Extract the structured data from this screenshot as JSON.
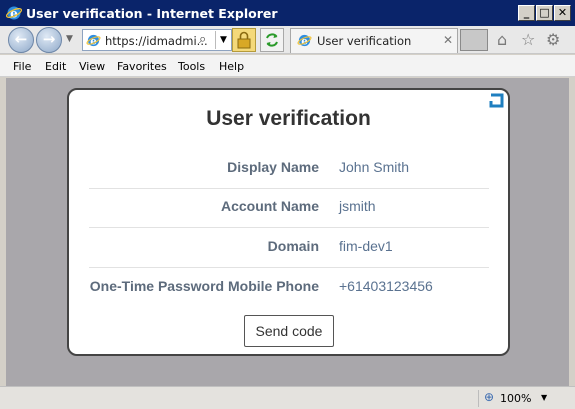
{
  "window": {
    "title": "User verification - Internet Explorer",
    "min_glyph": "_",
    "max_glyph": "□",
    "close_glyph": "✕"
  },
  "navbar": {
    "back_glyph": "←",
    "forward_glyph": "→",
    "address_url": "https://idmadmi...",
    "tab_label": "User verification",
    "tab_close_glyph": "✕",
    "icons": [
      "home-icon",
      "favorites-star-icon",
      "tools-gear-icon"
    ]
  },
  "menubar": {
    "items": [
      "File",
      "Edit",
      "View",
      "Favorites",
      "Tools",
      "Help"
    ]
  },
  "card": {
    "title": "User verification",
    "rows": [
      {
        "label": "Display Name",
        "value": "John Smith"
      },
      {
        "label": "Account Name",
        "value": "jsmith"
      },
      {
        "label": "Domain",
        "value": "fim-dev1"
      },
      {
        "label": "One-Time Password Mobile Phone",
        "value": "+61403123456"
      }
    ],
    "button_label": "Send code"
  },
  "statusbar": {
    "zoom_label": "100%"
  },
  "colors": {
    "titlebar": "#0a246a",
    "content_background": "#a9a7ab",
    "label_text": "#5d6b7c",
    "value_text": "#5a7290",
    "corner_icon": "#1f7fc0"
  }
}
